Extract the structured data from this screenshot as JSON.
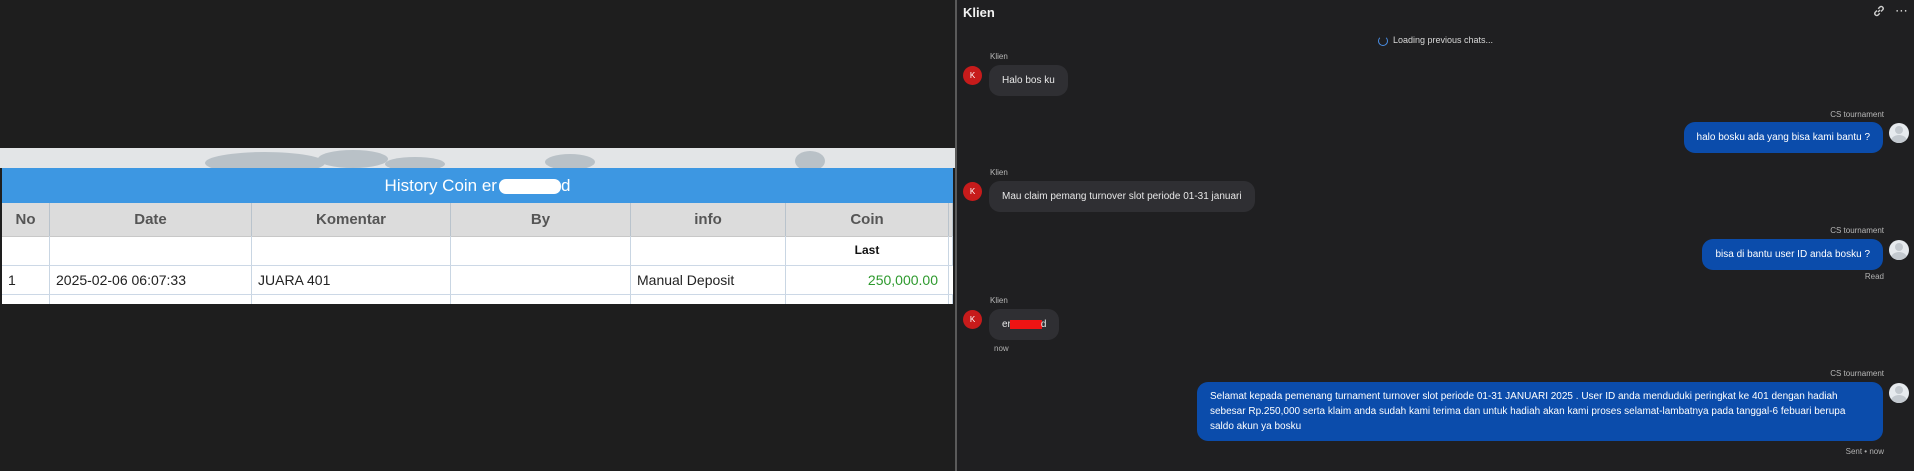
{
  "history": {
    "title": "History Coin er",
    "title_suffix": "d",
    "columns": [
      "No",
      "Date",
      "Komentar",
      "By",
      "info",
      "Coin"
    ],
    "sub_header": "Last",
    "rows": [
      {
        "no": "1",
        "date": "2025-02-06 06:07:33",
        "komentar": "JUARA 401",
        "by": "",
        "info": "Manual Deposit",
        "coin": "250,000.00"
      }
    ]
  },
  "chat": {
    "title": "Klien",
    "loading_text": "Loading previous chats...",
    "messages": [
      {
        "sender": "Klien",
        "avatar": "K",
        "text": "Halo bos ku"
      },
      {
        "sender": "CS tournament",
        "text": "halo bosku ada yang bisa kami bantu ?"
      },
      {
        "sender": "Klien",
        "avatar": "K",
        "text": "Mau claim pemang turnover slot periode 01-31 januari"
      },
      {
        "sender": "CS tournament",
        "text": "bisa di bantu user ID anda bosku ?",
        "status": "Read"
      },
      {
        "sender": "Klien",
        "avatar": "K",
        "text_prefix": "er",
        "text_suffix": "d",
        "time": "now"
      },
      {
        "sender": "CS tournament",
        "text": "Selamat kepada pemenang turnament turnover slot periode 01-31 JANUARI 2025 . User ID anda menduduki peringkat ke 401 dengan hadiah sebesar Rp.250,000 serta klaim anda sudah kami terima dan untuk hadiah akan kami proses selamat-lambatnya pada tanggal-6 febuari berupa saldo akun ya bosku",
        "status": "Sent • now"
      }
    ]
  },
  "colors": {
    "table_header_blue": "#3d97e2",
    "coin_green": "#2e9a2e",
    "out_bubble": "#0b4cab",
    "avatar_red": "#c71b1b"
  }
}
